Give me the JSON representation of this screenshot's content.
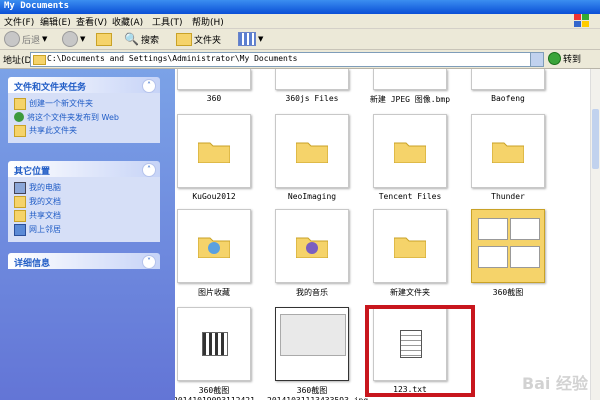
{
  "window": {
    "title": "My Documents"
  },
  "menu": [
    "文件(F)",
    "编辑(E)",
    "查看(V)",
    "收藏(A)",
    "工具(T)",
    "帮助(H)"
  ],
  "toolbar": {
    "back": "后退",
    "search": "搜索",
    "folders": "文件夹"
  },
  "address": {
    "label": "地址(D)",
    "path": "C:\\Documents and Settings\\Administrator\\My Documents",
    "go": "转到"
  },
  "left_panels": {
    "tasks": {
      "title": "文件和文件夹任务",
      "items": [
        "创建一个新文件夹",
        "将这个文件夹发布到 Web",
        "共享此文件夹"
      ]
    },
    "places": {
      "title": "其它位置",
      "items": [
        "我的电脑",
        "我的文档",
        "共享文档",
        "网上邻居"
      ]
    },
    "details": {
      "title": "详细信息"
    }
  },
  "files": {
    "row0": [
      "360",
      "360js Files",
      "新建 JPEG 图像.bmp",
      "Baofeng"
    ],
    "row1": [
      "KuGou2012",
      "NeoImaging",
      "Tencent Files",
      "Thunder"
    ],
    "row2": [
      "图片收藏",
      "我的音乐",
      "新建文件夹",
      "360截图"
    ],
    "row3": [
      "360截图 20141019093112421",
      "360截图 20141031113433593.jpg",
      "123.txt"
    ]
  },
  "watermark": "Bai 经验",
  "colors": {
    "highlight_box": "#c8161d",
    "left_pane": "#7ba2e7",
    "folder": "#f5d36a"
  }
}
